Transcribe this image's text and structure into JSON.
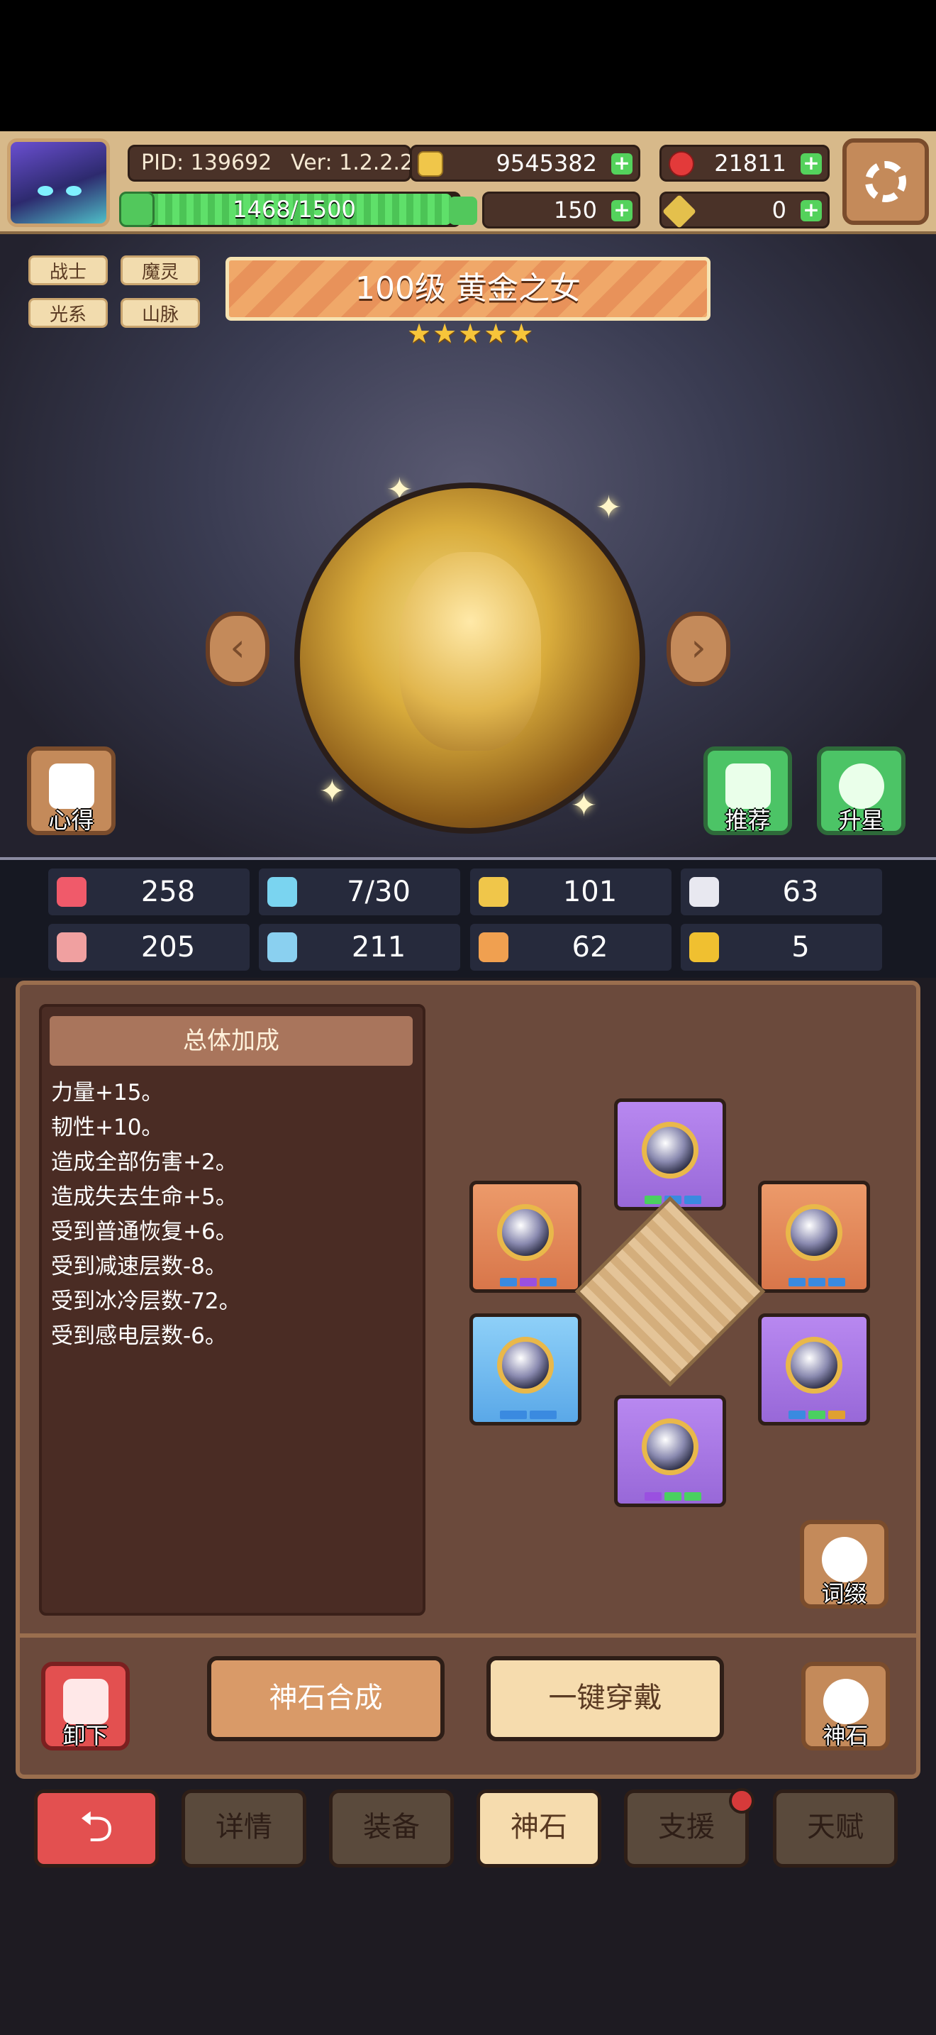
{
  "header": {
    "pid": "PID: 139692",
    "version": "Ver: 1.2.2.2",
    "gold": "9545382",
    "gems": "21811",
    "hp": "1468/1500",
    "hp_fraction": 0.979,
    "clover": "150",
    "keys": "0"
  },
  "tags": [
    "战士",
    "魔灵",
    "光系",
    "山脉"
  ],
  "hero": {
    "title": "100级  黄金之女",
    "stars": "★★★★★",
    "star_count": 5
  },
  "side_buttons": {
    "notes": "心得",
    "recommend": "推荐",
    "star_up": "升星"
  },
  "stats": [
    {
      "icon": "heart-icon",
      "value": "258",
      "color": "#f05a6a"
    },
    {
      "icon": "water-drop-icon",
      "value": "7/30",
      "color": "#7ad4f0"
    },
    {
      "icon": "shield-icon",
      "value": "101",
      "color": "#f0c64a"
    },
    {
      "icon": "wing-icon",
      "value": "63",
      "color": "#e8e8f0"
    },
    {
      "icon": "fist-icon",
      "value": "205",
      "color": "#f0a0a0"
    },
    {
      "icon": "book-icon",
      "value": "211",
      "color": "#8ad0f0"
    },
    {
      "icon": "scroll-icon",
      "value": "62",
      "color": "#f0a050"
    },
    {
      "icon": "magnet-icon",
      "value": "5",
      "color": "#f0c030"
    }
  ],
  "bonus_panel": {
    "title": "总体加成",
    "lines": [
      "力量+15。",
      "韧性+10。",
      "造成全部伤害+2。",
      "造成失去生命+5。",
      "受到普通恢复+6。",
      "受到减速层数-8。",
      "受到冰冷层数-72。",
      "受到感电层数-6。"
    ]
  },
  "slots": [
    {
      "pos": "top",
      "color": "purple",
      "dots": [
        "#4ad060",
        "#3a8ae0",
        "#3a8ae0"
      ]
    },
    {
      "pos": "upper-left",
      "color": "orange",
      "dots": [
        "#3a8ae0",
        "#9a50e0",
        "#3a8ae0"
      ]
    },
    {
      "pos": "upper-right",
      "color": "orange",
      "dots": [
        "#3a8ae0",
        "#3a8ae0",
        "#3a8ae0"
      ]
    },
    {
      "pos": "lower-left",
      "color": "blue",
      "dots": [
        "#3a8ae0",
        "#3a8ae0"
      ]
    },
    {
      "pos": "lower-right",
      "color": "purple",
      "dots": [
        "#3a8ae0",
        "#4ad060",
        "#e0a030"
      ]
    },
    {
      "pos": "bottom",
      "color": "purple",
      "dots": [
        "#9a50e0",
        "#4ad060",
        "#4ad060"
      ]
    }
  ],
  "actions": {
    "affix": "词缀",
    "unequip": "卸下",
    "synthesize": "神石合成",
    "equip_all": "一键穿戴",
    "god_stone": "神石"
  },
  "nav": {
    "back": "⮌",
    "details": "详情",
    "equipment": "装备",
    "god_stone": "神石",
    "support": "支援",
    "talent": "天赋"
  }
}
